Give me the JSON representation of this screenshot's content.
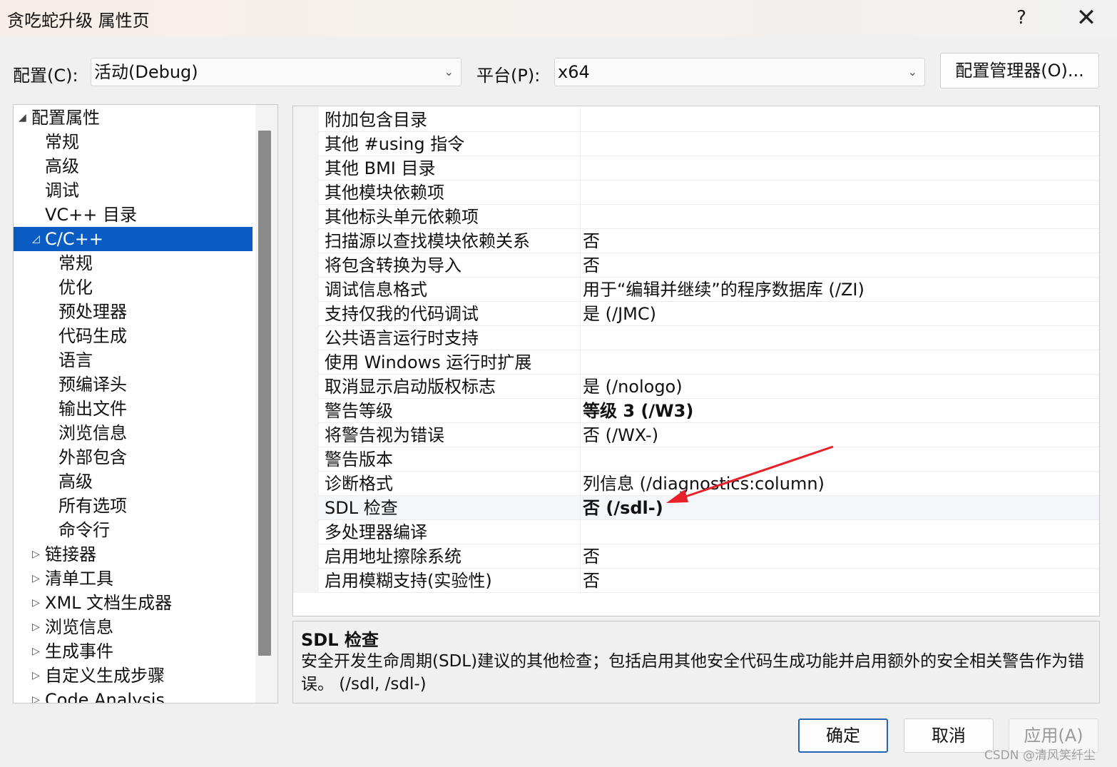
{
  "window": {
    "title": "贪吃蛇升级 属性页",
    "help_label": "?",
    "close_label": "✕"
  },
  "toolbar": {
    "config_label": "配置(C):",
    "config_value": "活动(Debug)",
    "platform_label": "平台(P):",
    "platform_value": "x64",
    "config_manager_label": "配置管理器(O)..."
  },
  "tree": {
    "items": [
      {
        "label": "配置属性",
        "arrow": "◢"
      },
      {
        "label": "常规",
        "arrow": ""
      },
      {
        "label": "高级",
        "arrow": ""
      },
      {
        "label": "调试",
        "arrow": ""
      },
      {
        "label": "VC++ 目录",
        "arrow": ""
      },
      {
        "label": "C/C++",
        "arrow": "◿"
      },
      {
        "label": "常规",
        "arrow": ""
      },
      {
        "label": "优化",
        "arrow": ""
      },
      {
        "label": "预处理器",
        "arrow": ""
      },
      {
        "label": "代码生成",
        "arrow": ""
      },
      {
        "label": "语言",
        "arrow": ""
      },
      {
        "label": "预编译头",
        "arrow": ""
      },
      {
        "label": "输出文件",
        "arrow": ""
      },
      {
        "label": "浏览信息",
        "arrow": ""
      },
      {
        "label": "外部包含",
        "arrow": ""
      },
      {
        "label": "高级",
        "arrow": ""
      },
      {
        "label": "所有选项",
        "arrow": ""
      },
      {
        "label": "命令行",
        "arrow": ""
      },
      {
        "label": "链接器",
        "arrow": "▷"
      },
      {
        "label": "清单工具",
        "arrow": "▷"
      },
      {
        "label": "XML 文档生成器",
        "arrow": "▷"
      },
      {
        "label": "浏览信息",
        "arrow": "▷"
      },
      {
        "label": "生成事件",
        "arrow": "▷"
      },
      {
        "label": "自定义生成步骤",
        "arrow": "▷"
      },
      {
        "label": "Code Analysis",
        "arrow": "▷"
      }
    ],
    "selected_index": 5
  },
  "properties": [
    {
      "name": "附加包含目录",
      "value": ""
    },
    {
      "name": "其他 #using 指令",
      "value": ""
    },
    {
      "name": "其他 BMI 目录",
      "value": ""
    },
    {
      "name": "其他模块依赖项",
      "value": ""
    },
    {
      "name": "其他标头单元依赖项",
      "value": ""
    },
    {
      "name": "扫描源以查找模块依赖关系",
      "value": "否"
    },
    {
      "name": "将包含转换为导入",
      "value": "否"
    },
    {
      "name": "调试信息格式",
      "value": "用于“编辑并继续”的程序数据库 (/ZI)"
    },
    {
      "name": "支持仅我的代码调试",
      "value": "是 (/JMC)"
    },
    {
      "name": "公共语言运行时支持",
      "value": ""
    },
    {
      "name": "使用 Windows 运行时扩展",
      "value": ""
    },
    {
      "name": "取消显示启动版权标志",
      "value": "是 (/nologo)"
    },
    {
      "name": "警告等级",
      "value": "等级 3 (/W3)",
      "bold": true
    },
    {
      "name": "将警告视为错误",
      "value": "否 (/WX-)"
    },
    {
      "name": "警告版本",
      "value": ""
    },
    {
      "name": "诊断格式",
      "value": "列信息 (/diagnostics:column)"
    },
    {
      "name": "SDL 检查",
      "value": "否 (/sdl-)",
      "bold": true,
      "highlighted": true
    },
    {
      "name": "多处理器编译",
      "value": ""
    },
    {
      "name": "启用地址擦除系统",
      "value": "否"
    },
    {
      "name": "启用模糊支持(实验性)",
      "value": "否"
    }
  ],
  "description": {
    "title": "SDL 检查",
    "text": "安全开发生命周期(SDL)建议的其他检查；包括启用其他安全代码生成功能并启用额外的安全相关警告作为错误。    (/sdl, /sdl-)"
  },
  "buttons": {
    "ok": "确定",
    "cancel": "取消",
    "apply": "应用(A)"
  },
  "watermark": "CSDN @清风笑纤尘",
  "colors": {
    "selection": "#0a5cc2",
    "annotation_arrow": "#e8202a"
  }
}
